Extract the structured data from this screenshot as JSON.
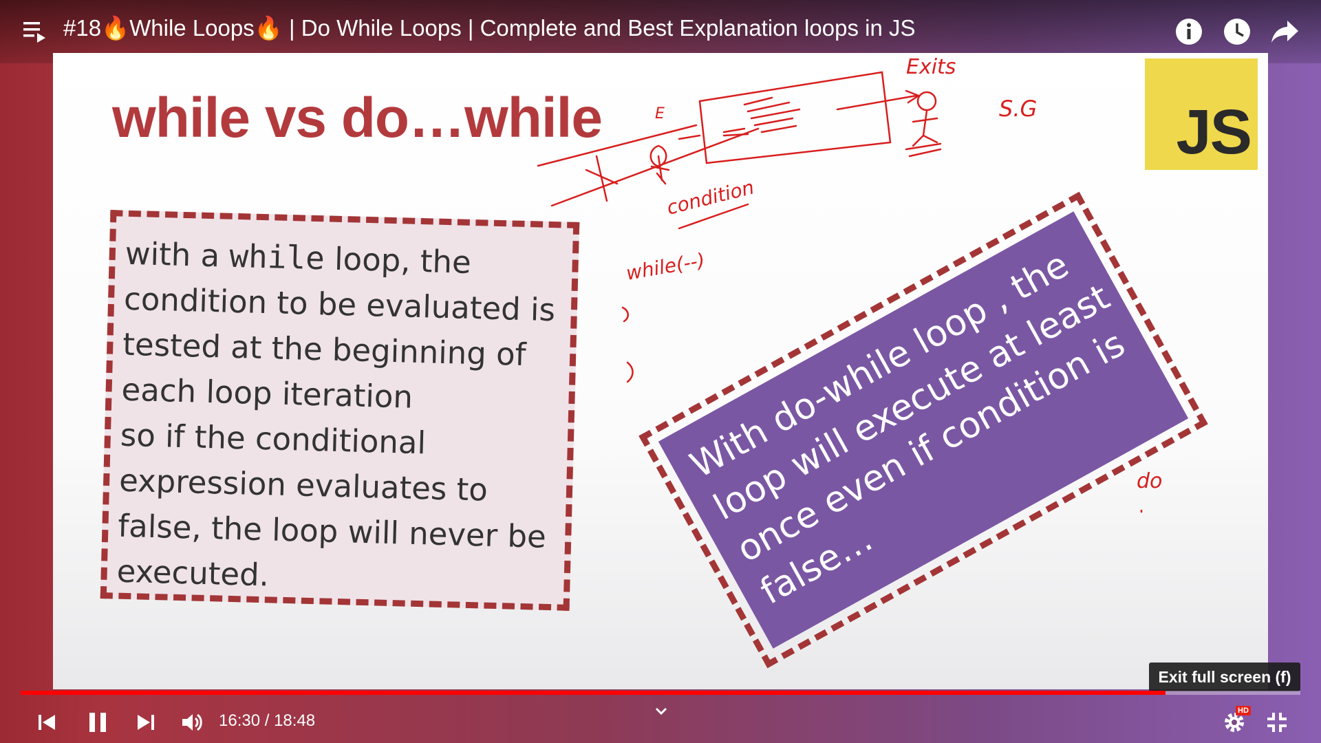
{
  "header": {
    "title": "#18🔥While Loops🔥 | Do While Loops | Complete and Best Explanation loops in JS",
    "icons": [
      "playlist-icon",
      "info-icon",
      "watch-later-icon",
      "share-icon"
    ]
  },
  "slide": {
    "title": "while vs do…while",
    "logo_text": "JS",
    "left_box": {
      "lines": [
        {
          "pre": "with a ",
          "code": "while",
          "post": " loop, the"
        },
        {
          "text": "condition to be evaluated is"
        },
        {
          "text": "tested at the beginning of"
        },
        {
          "text": "each loop iteration"
        },
        {
          "text": "so if the conditional"
        },
        {
          "text": "expression evaluates to"
        },
        {
          "text": "false, the loop will never be"
        },
        {
          "text": "executed."
        }
      ]
    },
    "right_box": {
      "lines": [
        "With do-while loop , the",
        "loop will execute at least",
        "once even if condition is",
        "false…"
      ]
    },
    "annotations": {
      "exits": "Exits",
      "sg": "S.G",
      "e": "E",
      "condition": "condition",
      "while": "while(--)",
      "do": "do"
    },
    "colors": {
      "title": "#b23a3d",
      "dash": "#a33537",
      "left_fill": "#efe3e8",
      "right_fill": "#7a57a3",
      "logo": "#efd84c",
      "ink": "#d81e1e"
    }
  },
  "player": {
    "tooltip": "Exit full screen (f)",
    "time": "16:30 / 18:48",
    "progress": 0.8945,
    "hd_badge": "HD",
    "controls": [
      "previous-icon",
      "pause-icon",
      "next-icon",
      "volume-icon",
      "chevron-down-icon",
      "settings-icon",
      "exit-fullscreen-icon"
    ]
  }
}
